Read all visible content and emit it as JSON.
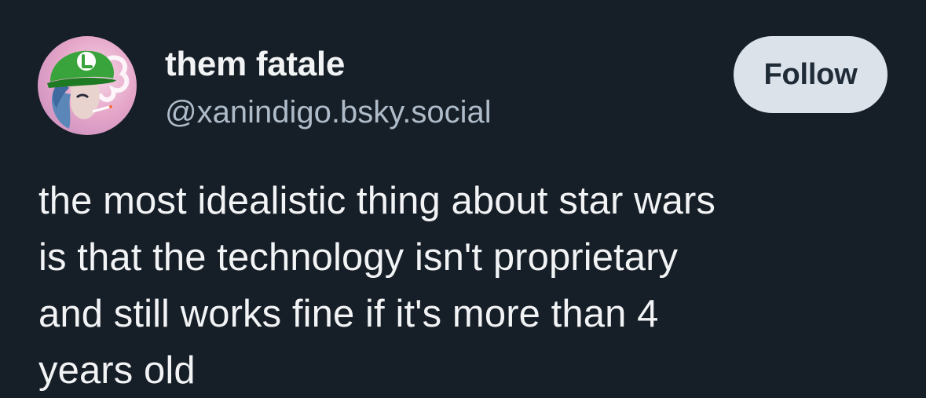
{
  "author": {
    "display_name": "them fatale",
    "handle": "@xanindigo.bsky.social",
    "avatar_icon": "avatar-green-cap-L-icon"
  },
  "follow_button": {
    "label": "Follow"
  },
  "post": {
    "lines": [
      "the most idealistic thing about star wars",
      "is that the technology isn't proprietary",
      "and still works fine if it's more than 4",
      "years old"
    ]
  },
  "colors": {
    "background": "#161e27",
    "text": "#f1f3f5",
    "handle": "#aebbc9",
    "button_bg": "#dce2ea",
    "button_text": "#1f2b37"
  }
}
